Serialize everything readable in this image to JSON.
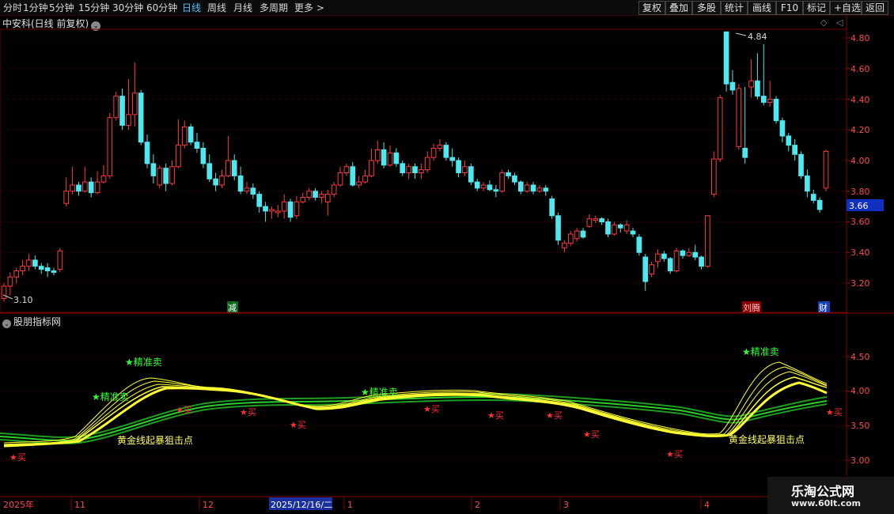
{
  "toolbar": {
    "periods": [
      "分时",
      "1分钟",
      "5分钟",
      "15分钟",
      "30分钟",
      "60分钟",
      "日线",
      "周线",
      "月线",
      "多周期",
      "更多 >"
    ],
    "active_period": "日线",
    "right_buttons": [
      "复权",
      "叠加",
      "多股",
      "统计",
      "画线",
      "F10",
      "标记",
      "+自选",
      "返回"
    ]
  },
  "stock_title": "中安科(日线 前复权)",
  "price_axis": {
    "ticks": [
      "4.80",
      "4.60",
      "4.40",
      "4.20",
      "4.00",
      "3.80",
      "3.60",
      "3.40",
      "3.20"
    ],
    "current_price": "3.66",
    "high_label": "4.84",
    "low_label": "3.10"
  },
  "event_tags": [
    "减",
    "刘腾",
    "财"
  ],
  "indicator": {
    "title": "股朋指标网",
    "ticks": [
      "4.50",
      "4.00",
      "3.50",
      "3.00"
    ],
    "sell_signals": [
      "精准卖",
      "精准卖",
      "精准卖",
      "精准卖"
    ],
    "buy_signal": "买",
    "golden_labels": [
      "黄金线起暴狙击点",
      "黄金线起暴狙击点"
    ]
  },
  "date_axis": {
    "labels": [
      "2025年",
      "11",
      "12",
      "2025/12/16/二",
      "1",
      "2",
      "3",
      "4"
    ]
  },
  "watermark": {
    "name": "乐淘公式网",
    "url": "www.60lt.com"
  },
  "colors": {
    "up": "#ff3b3b",
    "down": "#4de8f0",
    "yellow": "#ffff33",
    "green": "#2bd12b",
    "buy": "#ff3030",
    "sell": "#33ff33"
  },
  "chart_data": {
    "type": "candlestick",
    "title": "中安科(日线 前复权)",
    "ylim": [
      3.1,
      4.9
    ],
    "candles": [
      [
        3.1,
        3.18,
        3.2,
        3.08
      ],
      [
        3.18,
        3.24,
        3.27,
        3.12
      ],
      [
        3.24,
        3.28,
        3.3,
        3.2
      ],
      [
        3.28,
        3.31,
        3.35,
        3.25
      ],
      [
        3.31,
        3.35,
        3.39,
        3.28
      ],
      [
        3.35,
        3.31,
        3.38,
        3.29
      ],
      [
        3.31,
        3.29,
        3.33,
        3.26
      ],
      [
        3.3,
        3.28,
        3.33,
        3.24
      ],
      [
        3.28,
        3.27,
        3.3,
        3.25
      ],
      [
        3.29,
        3.41,
        3.43,
        3.27
      ],
      [
        3.72,
        3.8,
        3.89,
        3.7
      ],
      [
        3.8,
        3.84,
        3.96,
        3.78
      ],
      [
        3.84,
        3.8,
        3.86,
        3.77
      ],
      [
        3.8,
        3.86,
        3.96,
        3.79
      ],
      [
        3.86,
        3.79,
        3.89,
        3.76
      ],
      [
        3.79,
        3.86,
        3.93,
        3.78
      ],
      [
        3.86,
        3.9,
        3.97,
        3.85
      ],
      [
        3.9,
        4.28,
        4.31,
        3.88
      ],
      [
        4.28,
        4.42,
        4.45,
        4.26
      ],
      [
        4.42,
        4.23,
        4.47,
        4.2
      ],
      [
        4.23,
        4.3,
        4.53,
        4.2
      ],
      [
        4.3,
        4.44,
        4.64,
        4.22
      ],
      [
        4.44,
        4.12,
        4.46,
        4.1
      ],
      [
        4.12,
        3.98,
        4.17,
        3.95
      ],
      [
        3.98,
        3.9,
        4.04,
        3.85
      ],
      [
        3.84,
        3.95,
        3.97,
        3.82
      ],
      [
        3.95,
        3.85,
        3.98,
        3.8
      ],
      [
        3.85,
        3.96,
        4.0,
        3.84
      ],
      [
        3.96,
        4.1,
        4.27,
        3.95
      ],
      [
        4.1,
        4.22,
        4.26,
        4.08
      ],
      [
        4.22,
        4.12,
        4.24,
        4.1
      ],
      [
        4.12,
        4.08,
        4.18,
        4.05
      ],
      [
        4.08,
        3.98,
        4.12,
        3.95
      ],
      [
        3.98,
        3.88,
        4.04,
        3.86
      ],
      [
        3.88,
        3.84,
        3.92,
        3.8
      ],
      [
        3.84,
        3.9,
        3.94,
        3.82
      ],
      [
        3.9,
        4.0,
        4.16,
        3.89
      ],
      [
        4.0,
        3.9,
        4.04,
        3.87
      ],
      [
        3.9,
        3.8,
        3.96,
        3.78
      ],
      [
        3.8,
        3.82,
        3.86,
        3.78
      ],
      [
        3.82,
        3.78,
        3.85,
        3.75
      ],
      [
        3.78,
        3.7,
        3.8,
        3.66
      ],
      [
        3.7,
        3.67,
        3.73,
        3.6
      ],
      [
        3.67,
        3.68,
        3.7,
        3.62
      ],
      [
        3.66,
        3.67,
        3.71,
        3.63
      ],
      [
        3.67,
        3.73,
        3.78,
        3.62
      ],
      [
        3.73,
        3.63,
        3.75,
        3.6
      ],
      [
        3.64,
        3.73,
        3.77,
        3.62
      ],
      [
        3.73,
        3.76,
        3.79,
        3.72
      ],
      [
        3.76,
        3.8,
        3.82,
        3.74
      ],
      [
        3.8,
        3.76,
        3.82,
        3.74
      ],
      [
        3.76,
        3.78,
        3.8,
        3.72
      ],
      [
        3.73,
        3.78,
        3.81,
        3.64
      ],
      [
        3.78,
        3.84,
        3.86,
        3.76
      ],
      [
        3.84,
        3.92,
        3.96,
        3.83
      ],
      [
        3.92,
        3.96,
        3.98,
        3.9
      ],
      [
        3.96,
        3.84,
        3.99,
        3.83
      ],
      [
        3.84,
        3.86,
        3.9,
        3.82
      ],
      [
        3.86,
        3.9,
        3.94,
        3.85
      ],
      [
        3.9,
        4.0,
        4.08,
        3.89
      ],
      [
        4.0,
        4.07,
        4.13,
        3.98
      ],
      [
        4.07,
        3.97,
        4.12,
        3.95
      ],
      [
        3.97,
        4.05,
        4.1,
        3.96
      ],
      [
        4.05,
        3.98,
        4.08,
        3.96
      ],
      [
        3.98,
        3.92,
        4.0,
        3.9
      ],
      [
        3.92,
        3.96,
        3.98,
        3.88
      ],
      [
        3.96,
        3.92,
        3.98,
        3.88
      ],
      [
        3.92,
        3.94,
        3.98,
        3.88
      ],
      [
        3.94,
        4.02,
        4.06,
        3.92
      ],
      [
        4.02,
        4.08,
        4.11,
        4.0
      ],
      [
        4.08,
        4.1,
        4.14,
        4.06
      ],
      [
        4.1,
        4.02,
        4.12,
        4.0
      ],
      [
        4.02,
        4.0,
        4.08,
        3.96
      ],
      [
        4.0,
        3.92,
        4.02,
        3.89
      ],
      [
        3.92,
        3.96,
        4.0,
        3.9
      ],
      [
        3.96,
        3.86,
        3.98,
        3.84
      ],
      [
        3.86,
        3.82,
        3.88,
        3.8
      ],
      [
        3.82,
        3.84,
        3.86,
        3.8
      ],
      [
        3.84,
        3.81,
        3.87,
        3.8
      ],
      [
        3.81,
        3.8,
        3.84,
        3.76
      ],
      [
        3.8,
        3.92,
        3.94,
        3.79
      ],
      [
        3.92,
        3.9,
        3.94,
        3.88
      ],
      [
        3.9,
        3.86,
        3.92,
        3.84
      ],
      [
        3.86,
        3.8,
        3.87,
        3.78
      ],
      [
        3.8,
        3.84,
        3.86,
        3.79
      ],
      [
        3.84,
        3.8,
        3.86,
        3.78
      ],
      [
        3.8,
        3.82,
        3.84,
        3.79
      ],
      [
        3.82,
        3.8,
        3.84,
        3.77
      ],
      [
        3.75,
        3.64,
        3.77,
        3.62
      ],
      [
        3.64,
        3.48,
        3.66,
        3.45
      ],
      [
        3.43,
        3.46,
        3.48,
        3.4
      ],
      [
        3.46,
        3.52,
        3.54,
        3.44
      ],
      [
        3.49,
        3.54,
        3.56,
        3.47
      ],
      [
        3.54,
        3.5,
        3.56,
        3.49
      ],
      [
        3.57,
        3.62,
        3.65,
        3.56
      ],
      [
        3.61,
        3.62,
        3.64,
        3.59
      ],
      [
        3.62,
        3.6,
        3.63,
        3.58
      ],
      [
        3.6,
        3.52,
        3.62,
        3.5
      ],
      [
        3.52,
        3.58,
        3.6,
        3.51
      ],
      [
        3.58,
        3.56,
        3.59,
        3.53
      ],
      [
        3.54,
        3.58,
        3.61,
        3.52
      ],
      [
        3.54,
        3.52,
        3.56,
        3.5
      ],
      [
        3.5,
        3.4,
        3.52,
        3.38
      ],
      [
        3.37,
        3.21,
        3.39,
        3.15
      ],
      [
        3.26,
        3.32,
        3.34,
        3.24
      ],
      [
        3.34,
        3.39,
        3.42,
        3.3
      ],
      [
        3.39,
        3.36,
        3.41,
        3.34
      ],
      [
        3.36,
        3.28,
        3.37,
        3.26
      ],
      [
        3.28,
        3.41,
        3.43,
        3.27
      ],
      [
        3.41,
        3.38,
        3.42,
        3.36
      ],
      [
        3.38,
        3.4,
        3.43,
        3.37
      ],
      [
        3.4,
        3.37,
        3.45,
        3.35
      ],
      [
        3.37,
        3.31,
        3.38,
        3.29
      ],
      [
        3.31,
        3.64,
        3.64,
        3.3
      ],
      [
        3.78,
        4.01,
        4.06,
        3.76
      ],
      [
        4.01,
        4.41,
        4.43,
        3.99
      ],
      [
        4.84,
        4.5,
        4.84,
        4.45
      ],
      [
        4.51,
        4.46,
        4.59,
        4.43
      ],
      [
        4.09,
        4.47,
        4.5,
        4.07
      ],
      [
        4.08,
        4.02,
        4.48,
        3.98
      ],
      [
        4.48,
        4.52,
        4.66,
        4.41
      ],
      [
        4.52,
        4.42,
        4.7,
        4.4
      ],
      [
        4.42,
        4.38,
        4.76,
        4.36
      ],
      [
        4.38,
        4.4,
        4.52,
        4.35
      ],
      [
        4.4,
        4.26,
        4.42,
        4.24
      ],
      [
        4.26,
        4.16,
        4.28,
        4.12
      ],
      [
        4.16,
        4.1,
        4.18,
        4.06
      ],
      [
        4.1,
        4.04,
        4.14,
        4.0
      ],
      [
        4.04,
        3.9,
        4.06,
        3.88
      ],
      [
        3.9,
        3.8,
        3.94,
        3.76
      ],
      [
        3.78,
        3.74,
        3.81,
        3.72
      ],
      [
        3.74,
        3.68,
        3.76,
        3.66
      ],
      [
        3.82,
        4.06,
        4.07,
        3.8
      ]
    ]
  }
}
